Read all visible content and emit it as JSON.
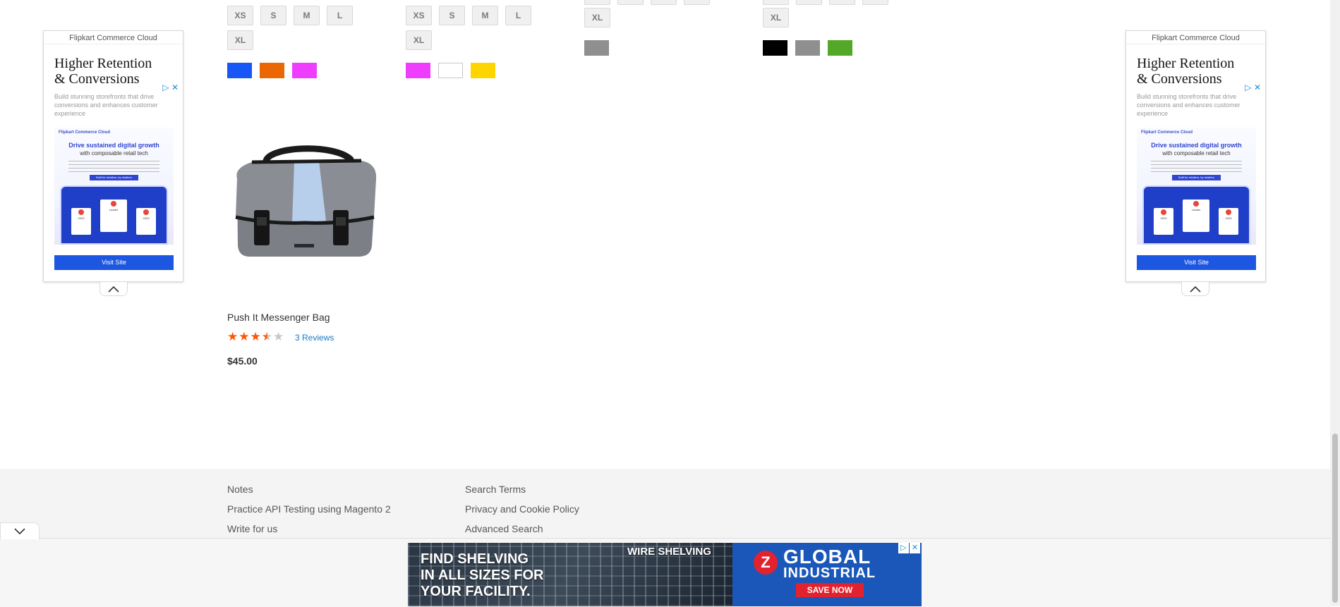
{
  "products_top": [
    {
      "sizes_row1": [
        "XS",
        "S",
        "M",
        "L"
      ],
      "sizes_row2": [
        "XL"
      ]
    },
    {
      "sizes_row1": [
        "XS",
        "S",
        "M",
        "L"
      ],
      "sizes_row2": [
        "XL"
      ]
    },
    {
      "sizes_row2": [
        "XL"
      ]
    },
    {
      "sizes_row2": [
        "XL"
      ]
    }
  ],
  "swatch_colors": {
    "p1": [
      "#1857f5",
      "#eb6703",
      "#ef3dff"
    ],
    "p2": [
      "#ef3dff",
      "#ffffff",
      "#ffd500"
    ],
    "p3": [
      "#8f8f8f"
    ],
    "p4": [
      "#000000",
      "#8f8f8f",
      "#53a828"
    ]
  },
  "side_ad": {
    "brand": "Flipkart Commerce Cloud",
    "headline_line1": "Higher Retention",
    "headline_line2": "& Conversions",
    "description": "Build stunning storefronts that drive conversions and enhances customer experience",
    "creative_logo": "Flipkart Commerce Cloud",
    "creative_headline": "Drive sustained digital growth",
    "creative_subhead": "with composable retail tech",
    "creative_tagline": "Built for retailers, by retailers",
    "badge_leader": "Leader",
    "badge_year": "2023",
    "cta": "Visit Site"
  },
  "product": {
    "name": "Push It Messenger Bag",
    "rating_fraction": 0.5,
    "reviews_label": "3 Reviews",
    "price": "$45.00"
  },
  "footer": {
    "col1": [
      "Notes",
      "Practice API Testing using Magento 2",
      "Write for us"
    ],
    "col2": [
      "Search Terms",
      "Privacy and Cookie Policy",
      "Advanced Search"
    ]
  },
  "banner": {
    "line1": "FIND SHELVING",
    "line2": "IN ALL SIZES FOR",
    "line3": "YOUR FACILITY.",
    "category": "WIRE SHELVING",
    "brand_line1": "GLOBAL",
    "brand_line2": "INDUSTRIAL",
    "cta": "SAVE NOW",
    "accent": "#e3222f",
    "brand_blue": "#1a57b8"
  },
  "colors": {
    "link": "#1979c3",
    "star": "#ff5501",
    "star_empty": "#c7c7c7"
  }
}
